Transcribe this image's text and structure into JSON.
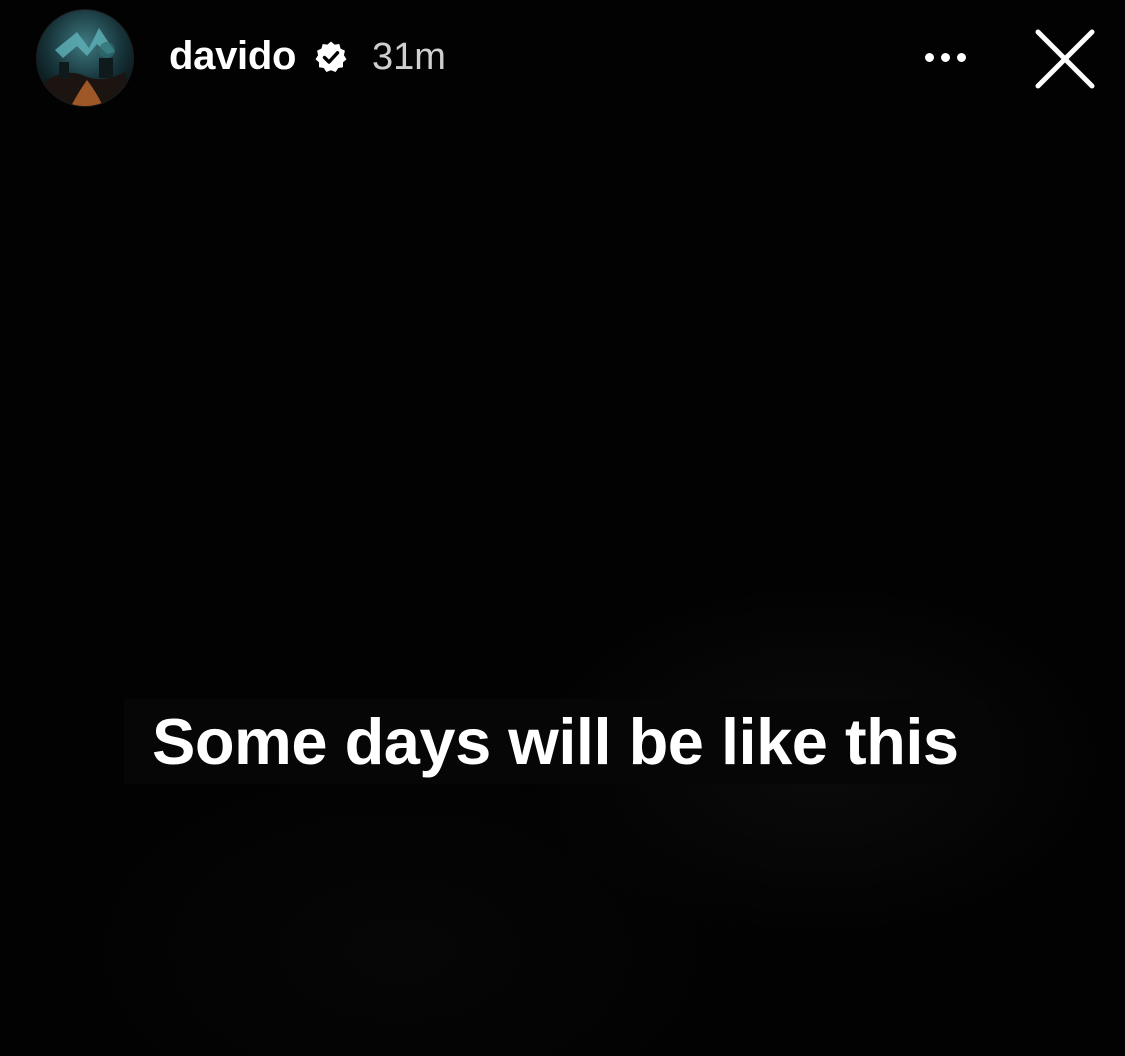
{
  "story": {
    "header": {
      "username": "davido",
      "verified": true,
      "timestamp": "31m",
      "avatar_icon": "avatar-image",
      "more_icon": "more-options-icon",
      "close_icon": "close-icon"
    },
    "caption": "Some days will be like this",
    "colors": {
      "background": "#000000",
      "text": "#ffffff",
      "timestamp": "#cfcfcf"
    }
  }
}
